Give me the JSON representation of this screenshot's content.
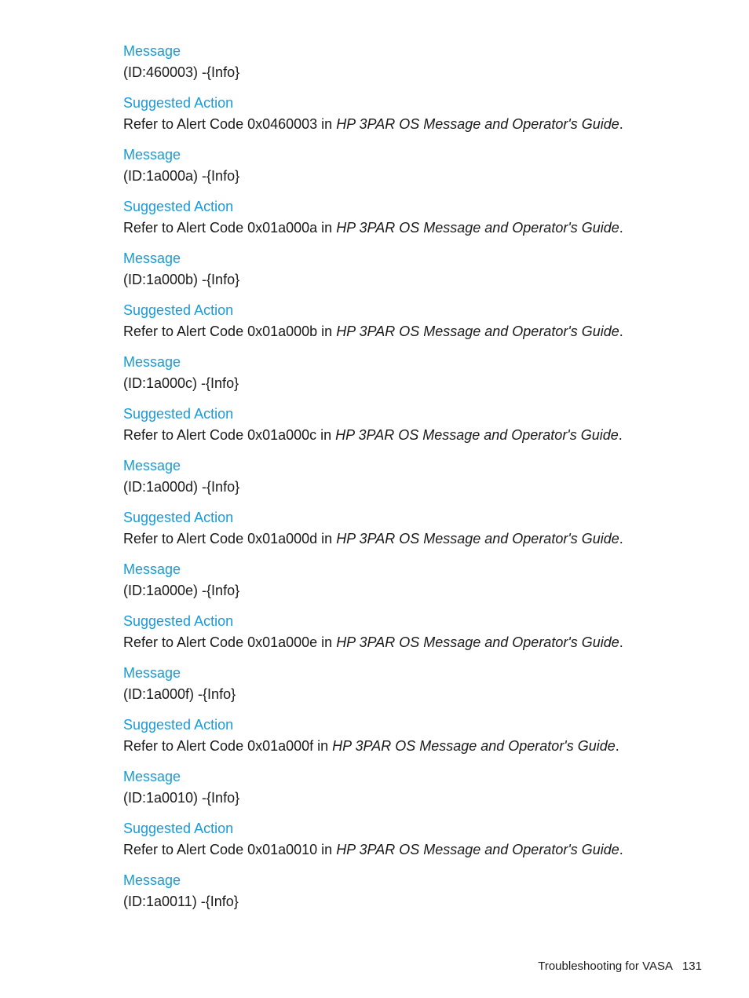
{
  "entries": [
    {
      "message_label": "Message",
      "message": "(ID:460003) -{Info}",
      "action_label": "Suggested Action",
      "action_prefix": "Refer to Alert Code 0x0460003 in ",
      "action_ref": "HP 3PAR OS Message and Operator's Guide",
      "action_suffix": "."
    },
    {
      "message_label": "Message",
      "message": "(ID:1a000a) -{Info}",
      "action_label": "Suggested Action",
      "action_prefix": "Refer to Alert Code 0x01a000a in ",
      "action_ref": "HP 3PAR OS Message and Operator's Guide",
      "action_suffix": "."
    },
    {
      "message_label": "Message",
      "message": "(ID:1a000b) -{Info}",
      "action_label": "Suggested Action",
      "action_prefix": "Refer to Alert Code 0x01a000b in ",
      "action_ref": "HP 3PAR OS Message and Operator's Guide",
      "action_suffix": "."
    },
    {
      "message_label": "Message",
      "message": "(ID:1a000c) -{Info}",
      "action_label": "Suggested Action",
      "action_prefix": "Refer to Alert Code 0x01a000c in ",
      "action_ref": "HP 3PAR OS Message and Operator's Guide",
      "action_suffix": "."
    },
    {
      "message_label": "Message",
      "message": "(ID:1a000d) -{Info}",
      "action_label": "Suggested Action",
      "action_prefix": "Refer to Alert Code 0x01a000d in ",
      "action_ref": "HP 3PAR OS Message and Operator's Guide",
      "action_suffix": "."
    },
    {
      "message_label": "Message",
      "message": "(ID:1a000e) -{Info}",
      "action_label": "Suggested Action",
      "action_prefix": "Refer to Alert Code 0x01a000e in ",
      "action_ref": "HP 3PAR OS Message and Operator's Guide",
      "action_suffix": "."
    },
    {
      "message_label": "Message",
      "message": "(ID:1a000f) -{Info}",
      "action_label": "Suggested Action",
      "action_prefix": "Refer to Alert Code 0x01a000f in ",
      "action_ref": "HP 3PAR OS Message and Operator's Guide",
      "action_suffix": "."
    },
    {
      "message_label": "Message",
      "message": "(ID:1a0010) -{Info}",
      "action_label": "Suggested Action",
      "action_prefix": "Refer to Alert Code 0x01a0010 in ",
      "action_ref": "HP 3PAR OS Message and Operator's Guide",
      "action_suffix": "."
    }
  ],
  "last_message": {
    "message_label": "Message",
    "message": "(ID:1a0011) -{Info}"
  },
  "footer": {
    "title": "Troubleshooting for VASA",
    "page": "131"
  },
  "colors": {
    "heading": "#1a9ad6",
    "text": "#1a1a1a"
  }
}
